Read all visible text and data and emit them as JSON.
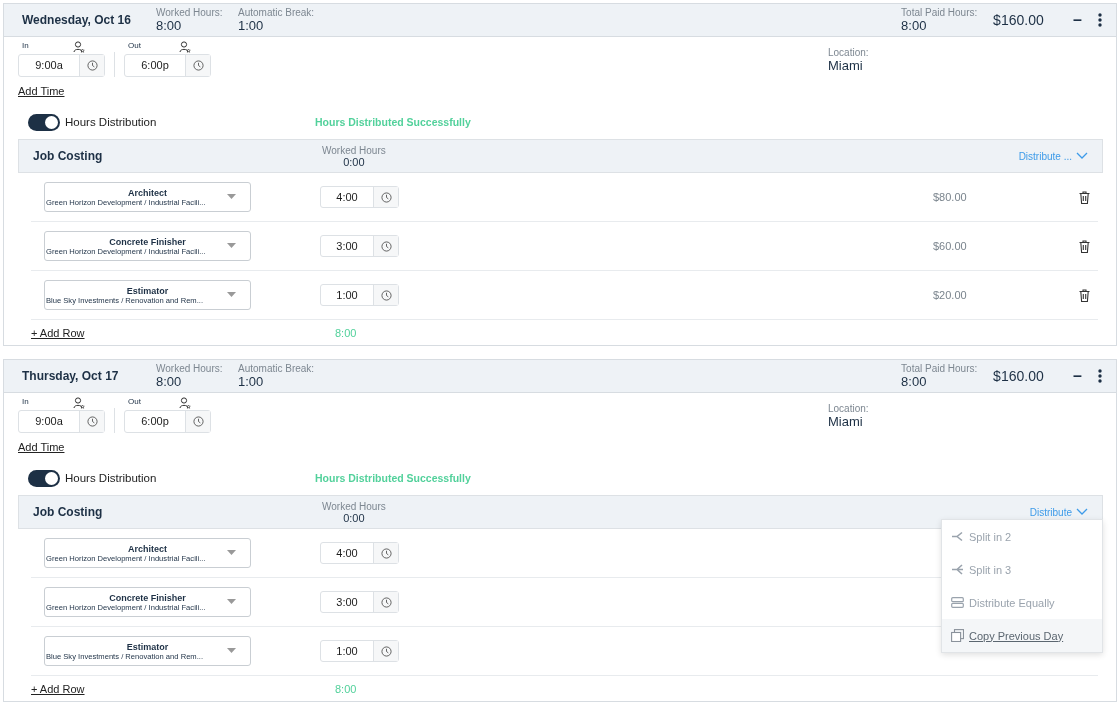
{
  "days": [
    {
      "title": "Wednesday, Oct 16",
      "worked_label": "Worked Hours:",
      "worked": "8:00",
      "break_label": "Automatic Break:",
      "break": "1:00",
      "paid_label": "Total Paid Hours:",
      "paid": "8:00",
      "amount": "$160.00",
      "collapse": "–",
      "in_label": "In",
      "in_time": "9:00a",
      "out_label": "Out",
      "out_time": "6:00p",
      "location_label": "Location:",
      "location": "Miami",
      "add_time": "Add Time",
      "toggle": {
        "label": "Hours Distribution",
        "on": true
      },
      "status": "Hours Distributed Successfully",
      "job_costing": {
        "title": "Job Costing",
        "worked_label": "Worked Hours",
        "worked": "0:00",
        "distribute": "Distribute ..."
      },
      "rows": [
        {
          "job": "Architect",
          "detail": "Green Horizon Development / Industrial Facili...",
          "hours": "4:00",
          "amount": "$80.00"
        },
        {
          "job": "Concrete Finisher",
          "detail": "Green Horizon Development / Industrial Facili...",
          "hours": "3:00",
          "amount": "$60.00"
        },
        {
          "job": "Estimator",
          "detail": "Blue Sky Investments / Renovation and Rem...",
          "hours": "1:00",
          "amount": "$20.00"
        }
      ],
      "add_row": "+ Add Row",
      "total": "8:00"
    },
    {
      "title": "Thursday, Oct 17",
      "worked_label": "Worked Hours:",
      "worked": "8:00",
      "break_label": "Automatic Break:",
      "break": "1:00",
      "paid_label": "Total Paid Hours:",
      "paid": "8:00",
      "amount": "$160.00",
      "collapse": "–",
      "in_label": "In",
      "in_time": "9:00a",
      "out_label": "Out",
      "out_time": "6:00p",
      "location_label": "Location:",
      "location": "Miami",
      "add_time": "Add Time",
      "toggle": {
        "label": "Hours Distribution",
        "on": true
      },
      "status": "Hours Distributed Successfully",
      "job_costing": {
        "title": "Job Costing",
        "worked_label": "Worked Hours",
        "worked": "0:00",
        "distribute": "Distribute",
        "menu": [
          {
            "kind": "split2",
            "label": "Split in 2",
            "selected": false
          },
          {
            "kind": "split3",
            "label": "Split in 3",
            "selected": false
          },
          {
            "kind": "equal",
            "label": "Distribute Equally",
            "selected": false
          },
          {
            "kind": "copy",
            "label": "Copy Previous Day",
            "selected": true
          }
        ]
      },
      "rows": [
        {
          "job": "Architect",
          "detail": "Green Horizon Development / Industrial Facili...",
          "hours": "4:00"
        },
        {
          "job": "Concrete Finisher",
          "detail": "Green Horizon Development / Industrial Facili...",
          "hours": "3:00"
        },
        {
          "job": "Estimator",
          "detail": "Blue Sky Investments / Renovation and Rem...",
          "hours": "1:00"
        }
      ],
      "add_row": "+ Add Row",
      "total": "8:00"
    }
  ]
}
